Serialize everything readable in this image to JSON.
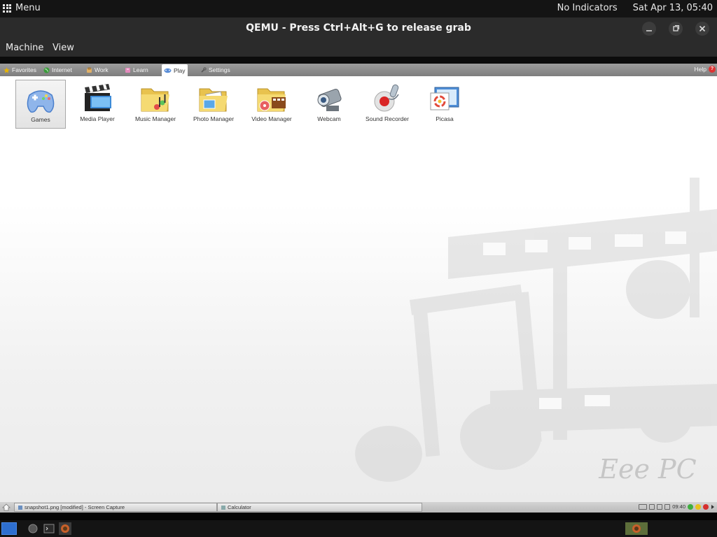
{
  "host": {
    "menu_label": "Menu",
    "indicators": "No Indicators",
    "datetime": "Sat Apr 13, 05:40"
  },
  "window": {
    "title": "QEMU - Press Ctrl+Alt+G to release grab",
    "menus": [
      "Machine",
      "View"
    ]
  },
  "eee": {
    "tabs": [
      {
        "label": "Favorites",
        "icon": "star-icon",
        "color": "#e8b400"
      },
      {
        "label": "Internet",
        "icon": "globe-icon",
        "color": "#3a9b3a"
      },
      {
        "label": "Work",
        "icon": "work-icon",
        "color": "#c98a3a"
      },
      {
        "label": "Learn",
        "icon": "learn-icon",
        "color": "#d76fa6"
      },
      {
        "label": "Play",
        "icon": "gamepad-icon",
        "color": "#4a7fcc"
      },
      {
        "label": "Settings",
        "icon": "wrench-icon",
        "color": "#7a7a7a"
      }
    ],
    "active_tab": "Play",
    "help_label": "Help",
    "help_glyph": "?",
    "apps": [
      {
        "label": "Games",
        "icon": "gamepad-icon"
      },
      {
        "label": "Media Player",
        "icon": "clapperboard-icon"
      },
      {
        "label": "Music Manager",
        "icon": "music-folder-icon"
      },
      {
        "label": "Photo Manager",
        "icon": "photo-folder-icon"
      },
      {
        "label": "Video Manager",
        "icon": "video-folder-icon"
      },
      {
        "label": "Webcam",
        "icon": "webcam-icon"
      },
      {
        "label": "Sound Recorder",
        "icon": "microphone-icon"
      },
      {
        "label": "Picasa",
        "icon": "picasa-icon"
      }
    ],
    "selected_app": "Games",
    "brand_watermark": "Eee PC",
    "taskbar": {
      "tasks": [
        "snapshot1.png [modified] - Screen Capture",
        "Calculator"
      ],
      "clock": "09:40"
    }
  }
}
